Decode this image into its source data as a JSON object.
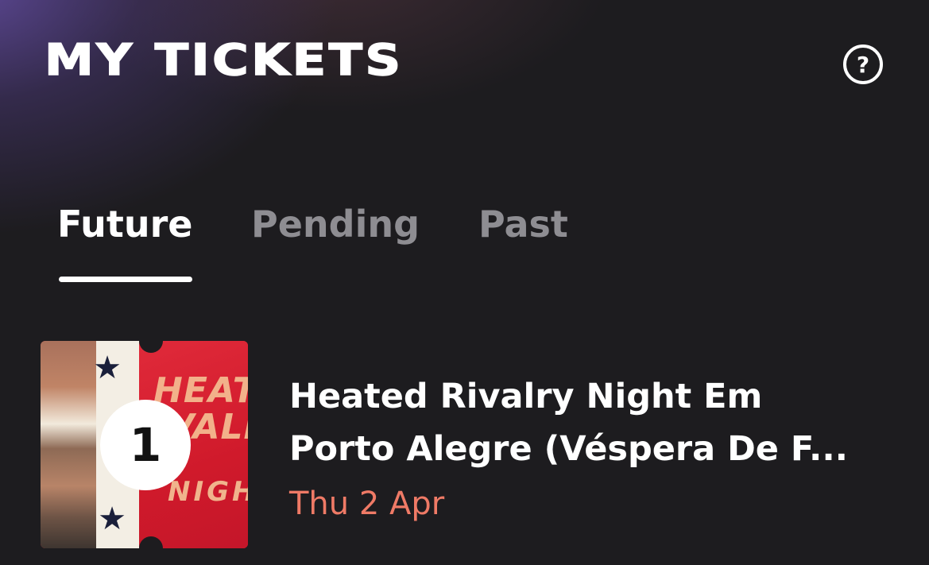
{
  "header": {
    "title": "MY TICKETS",
    "help_icon": "question-circle-icon",
    "help_glyph": "?"
  },
  "tabs": [
    {
      "label": "Future",
      "active": true
    },
    {
      "label": "Pending",
      "active": false
    },
    {
      "label": "Past",
      "active": false
    }
  ],
  "tickets": [
    {
      "title_line1": "Heated Rivalry Night Em",
      "title_line2": "Porto Alegre (Véspera De F...",
      "date": "Thu 2 Apr",
      "ticket_count": "1",
      "thumbnail_text": "HEATED RIVALRY NIGHT"
    }
  ],
  "colors": {
    "background": "#1d1c1f",
    "accent_date": "#ef7a66",
    "tab_inactive": "#8e8d92",
    "text_primary": "#ffffff"
  }
}
